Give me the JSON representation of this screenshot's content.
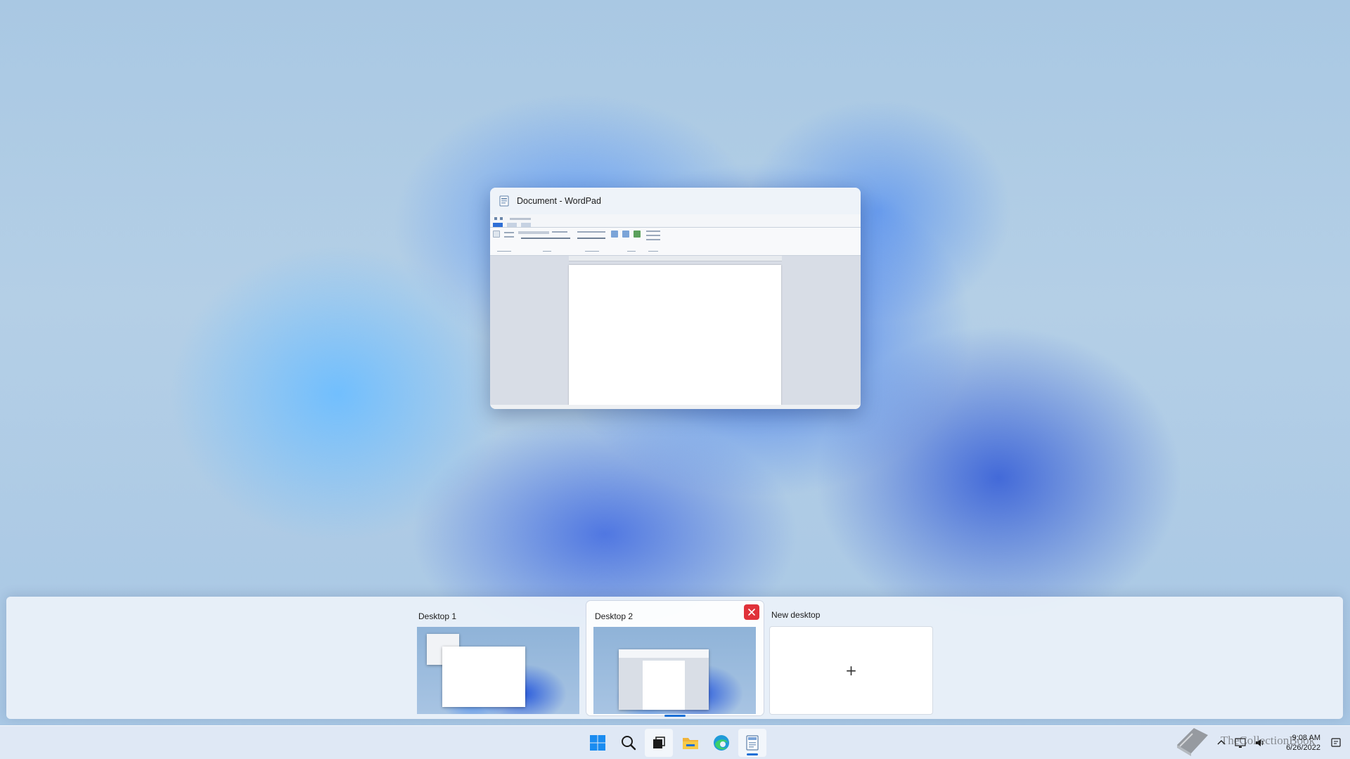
{
  "window_preview": {
    "title": "Document - WordPad",
    "app_icon": "wordpad-icon"
  },
  "desktops": [
    {
      "label": "Desktop 1",
      "active": false
    },
    {
      "label": "Desktop 2",
      "active": true,
      "close_icon": "close-icon"
    },
    {
      "label": "New desktop",
      "add_icon": "+"
    }
  ],
  "taskbar": {
    "apps": [
      "start-icon",
      "search-icon",
      "task-view-icon",
      "file-explorer-icon",
      "edge-icon",
      "wordpad-icon"
    ]
  },
  "tray": {
    "time": "9:08 AM",
    "date": "6/26/2022"
  },
  "watermark": {
    "text": "TheCollectionBook"
  },
  "colors": {
    "accent": "#1a6fd6",
    "close": "#e0323a"
  }
}
